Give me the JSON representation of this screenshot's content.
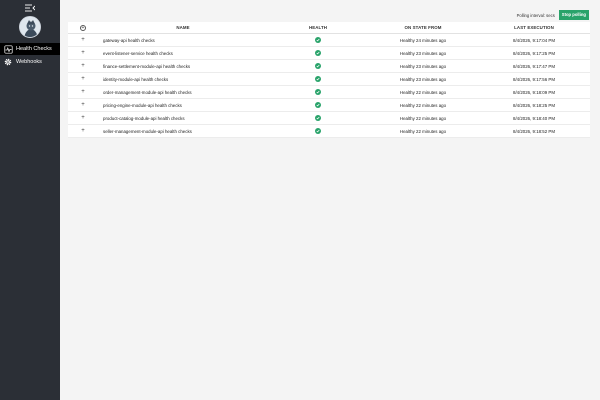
{
  "sidebar": {
    "menu_icon": "collapse-menu-icon",
    "items": [
      {
        "label": "Health Checks",
        "icon": "heartbeat-icon",
        "active": true
      },
      {
        "label": "Webhooks",
        "icon": "gear-icon",
        "active": false
      }
    ]
  },
  "topbar": {
    "polling_label": "Polling interval: secs",
    "stop_label": "Stop polling"
  },
  "table": {
    "columns": {
      "name": "NAME",
      "health": "HEALTH",
      "state": "ON STATE FROM",
      "exec": "LAST EXECUTION"
    },
    "rows": [
      {
        "name": "gateway-api health checks",
        "health": "healthy",
        "state": "Healthy 24 minutes ago",
        "exec": "8/4/2026, 9:17:04 PM"
      },
      {
        "name": "event-listener-service health checks",
        "health": "healthy",
        "state": "Healthy 23 minutes ago",
        "exec": "8/4/2026, 9:17:25 PM"
      },
      {
        "name": "finance-settlement-module-api health checks",
        "health": "healthy",
        "state": "Healthy 23 minutes ago",
        "exec": "8/4/2026, 9:17:47 PM"
      },
      {
        "name": "identity-module-api health checks",
        "health": "healthy",
        "state": "Healthy 23 minutes ago",
        "exec": "8/4/2026, 9:17:56 PM"
      },
      {
        "name": "order-management-module-api health checks",
        "health": "healthy",
        "state": "Healthy 22 minutes ago",
        "exec": "8/4/2026, 9:18:09 PM"
      },
      {
        "name": "pricing-engine-module-api health checks",
        "health": "healthy",
        "state": "Healthy 22 minutes ago",
        "exec": "8/4/2026, 9:18:25 PM"
      },
      {
        "name": "product-catalog-module-api health checks",
        "health": "healthy",
        "state": "Healthy 22 minutes ago",
        "exec": "8/4/2026, 9:18:40 PM"
      },
      {
        "name": "seller-management-module-api health checks",
        "health": "healthy",
        "state": "Healthy 22 minutes ago",
        "exec": "8/4/2026, 9:18:52 PM"
      }
    ]
  },
  "colors": {
    "sidebar_bg": "#2b2f36",
    "active_nav_bg": "#000000",
    "accent_green": "#29a36a",
    "page_bg": "#f4f4f4"
  }
}
